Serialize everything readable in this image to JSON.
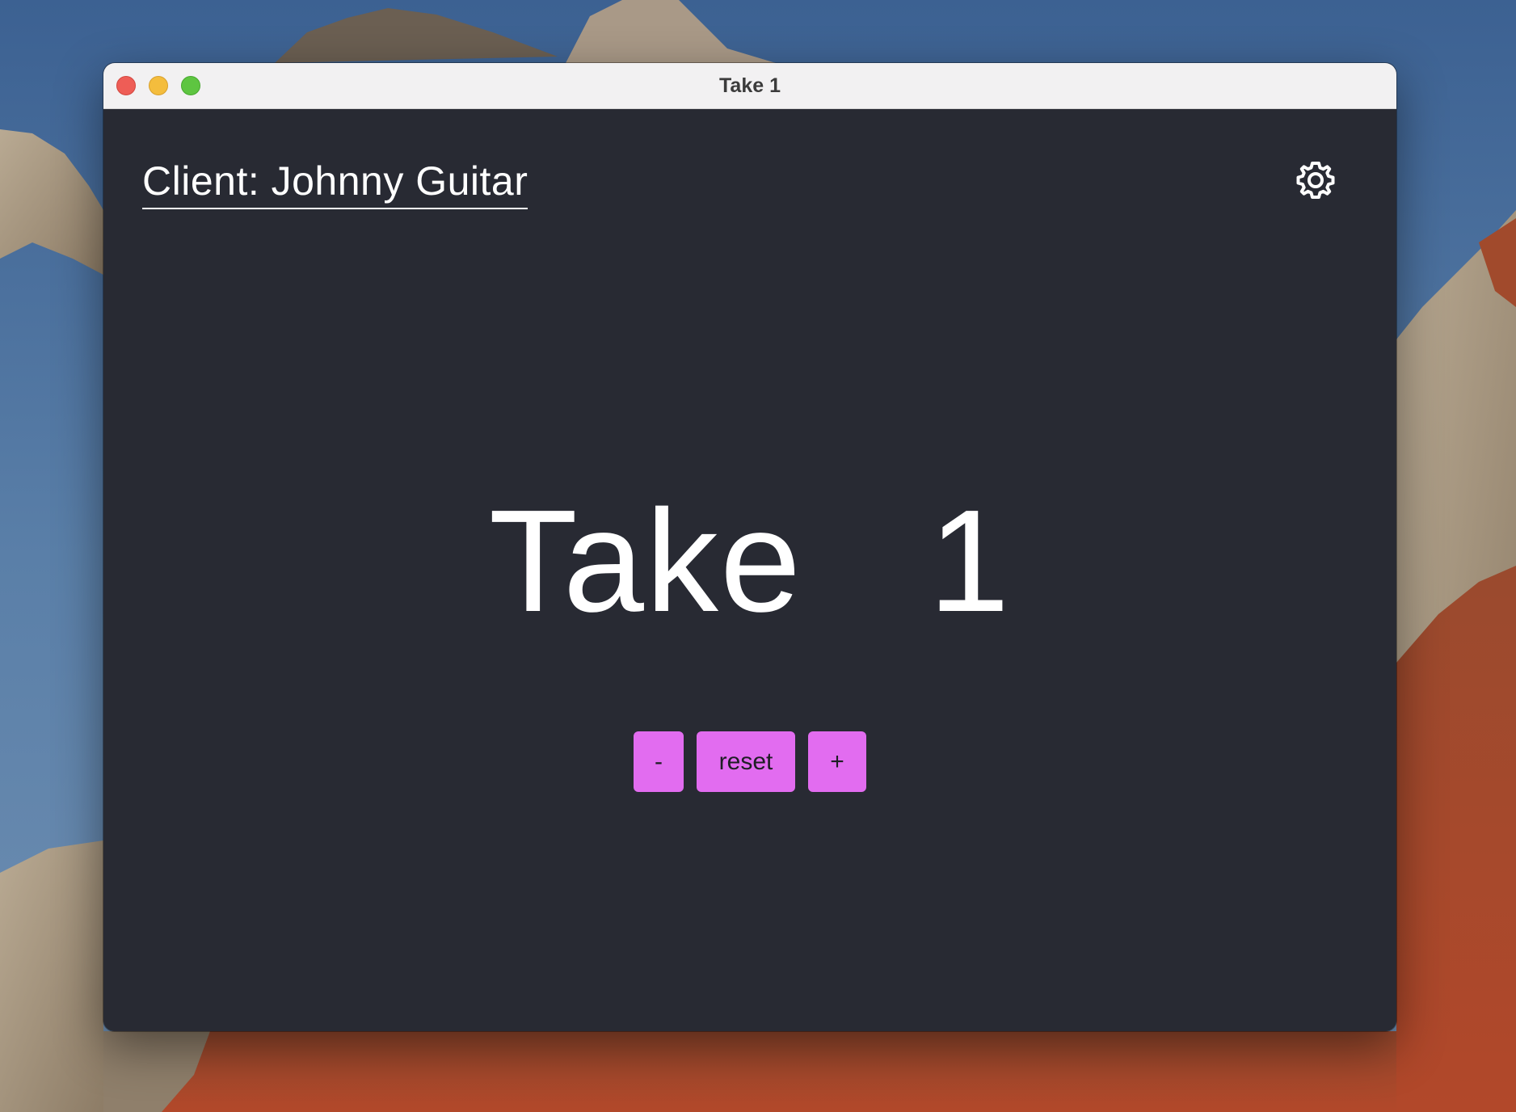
{
  "window": {
    "title": "Take 1"
  },
  "header": {
    "client_label": "Client: Johnny Guitar",
    "settings_icon": "gear-icon"
  },
  "take": {
    "label": "Take",
    "number": "1"
  },
  "controls": {
    "decrement_label": "-",
    "reset_label": "reset",
    "increment_label": "+"
  },
  "colors": {
    "background": "#282a33",
    "button": "#e26cf0",
    "text": "#ffffff"
  }
}
